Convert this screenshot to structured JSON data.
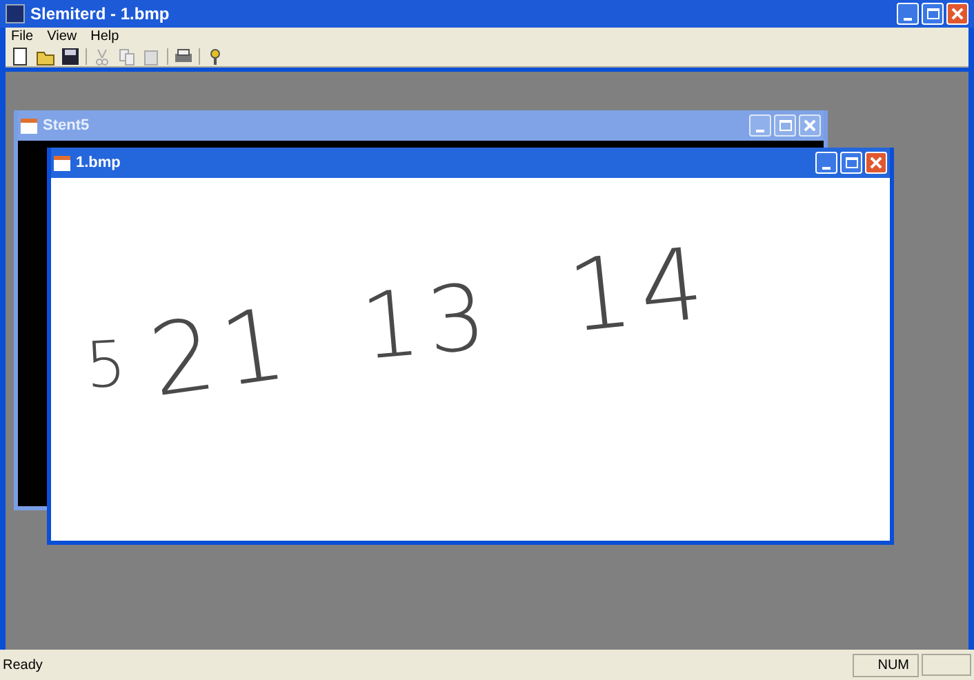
{
  "window": {
    "title": "Slemiterd - 1.bmp"
  },
  "menu": [
    "File",
    "View",
    "Help"
  ],
  "child_windows": [
    {
      "title": "Stent5",
      "active": false
    },
    {
      "title": "1.bmp",
      "active": true,
      "digits": [
        "5",
        "21",
        "13",
        "14"
      ]
    }
  ],
  "status_bar": {
    "message": "Ready",
    "indicators": [
      "NUM"
    ]
  }
}
